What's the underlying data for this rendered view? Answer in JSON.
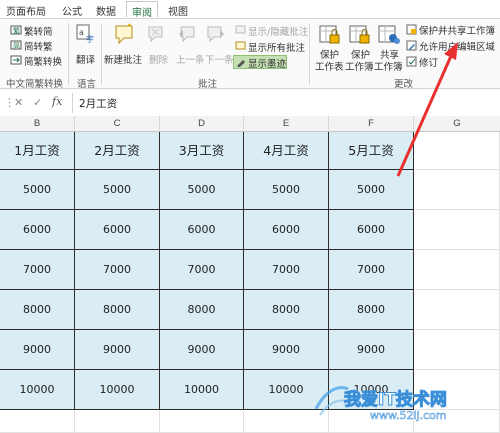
{
  "ribbon_tabs": {
    "page_layout": "页面布局",
    "formulas": "公式",
    "data": "数据",
    "review": "审阅",
    "view": "视图"
  },
  "ribbon": {
    "chinese_conversion": {
      "to_simplified": "繁转简",
      "to_traditional": "简转繁",
      "conversion": "简繁转换",
      "group": "中文简繁转换"
    },
    "language": {
      "translate": "翻译",
      "group": "语言"
    },
    "comments": {
      "new_comment": "新建批注",
      "delete": "删除",
      "previous": "上一条",
      "next": "下一条",
      "show_hide": "显示/隐藏批注",
      "show_all": "显示所有批注",
      "show_ink": "显示墨迹",
      "group": "批注"
    },
    "changes": {
      "protect_sheet_line1": "保护",
      "protect_sheet_line2": "工作表",
      "protect_workbook_line1": "保护",
      "protect_workbook_line2": "工作簿",
      "share_workbook_line1": "共享",
      "share_workbook_line2": "工作簿",
      "protect_and_share": "保护并共享工作簿",
      "allow_edit_ranges": "允许用户编辑区域",
      "track_changes": "修订",
      "group": "更改"
    }
  },
  "formula_bar": {
    "cancel": "✕",
    "enter": "✓",
    "fx": "fx",
    "content": "2月工资"
  },
  "columns": [
    "B",
    "C",
    "D",
    "E",
    "F",
    "G"
  ],
  "table": {
    "headers": [
      "1月工资",
      "2月工资",
      "3月工资",
      "4月工资",
      "5月工资"
    ],
    "rows": [
      [
        "5000",
        "5000",
        "5000",
        "5000",
        "5000"
      ],
      [
        "6000",
        "6000",
        "6000",
        "6000",
        "6000"
      ],
      [
        "7000",
        "7000",
        "7000",
        "7000",
        "7000"
      ],
      [
        "8000",
        "8000",
        "8000",
        "8000",
        "8000"
      ],
      [
        "9000",
        "9000",
        "9000",
        "9000",
        "9000"
      ],
      [
        "10000",
        "10000",
        "10000",
        "10000",
        "10000"
      ]
    ]
  },
  "watermark": {
    "main": "我爱IT技术网",
    "url": "www.52ij.com"
  },
  "colors": {
    "accent_green": "#217346",
    "table_fill": "#daedf4",
    "arrow_red": "#e8312f"
  }
}
